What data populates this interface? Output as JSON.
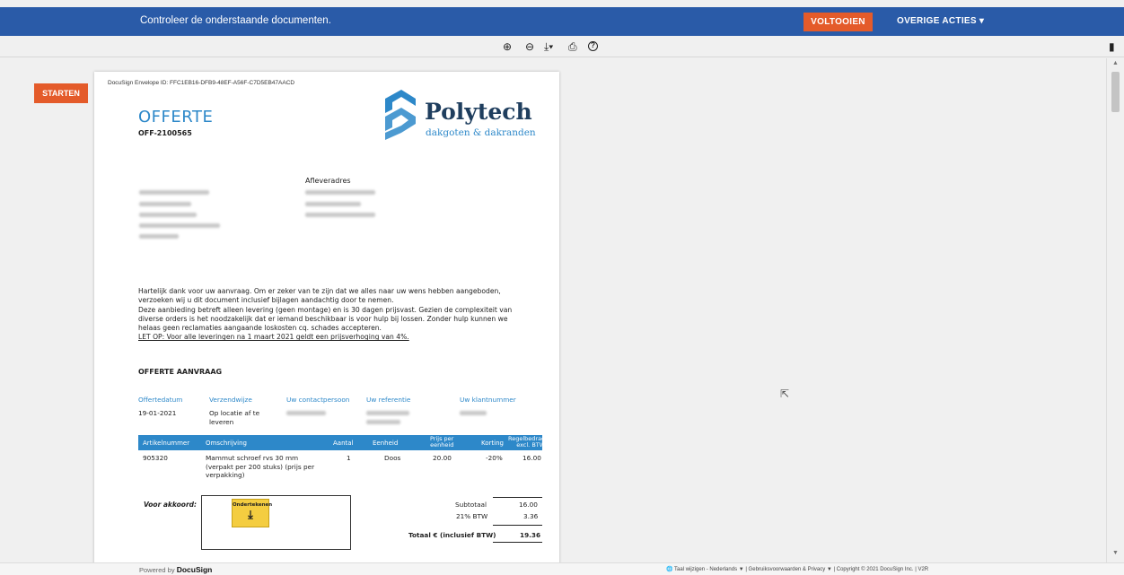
{
  "topbar": {
    "message": "Controleer de onderstaande documenten.",
    "finish_label": "VOLTOOIEN",
    "other_label": "OVERIGE ACTIES ▾",
    "color": "#2a5ba8",
    "accent": "#e45b2a"
  },
  "toolbar": {
    "zoom_in": "⊕",
    "zoom_out": "⊖",
    "download": "⤓▾",
    "print": "⎙",
    "help": "?",
    "side_doc": "▮"
  },
  "start_label": "STARTEN",
  "document": {
    "envelope_id": "DocuSign Envelope ID: FFC1EB16-DFB9-48EF-A56F-C7D5EB47AACD",
    "title": "OFFERTE",
    "number": "OFF-2100565",
    "brand": "Polytech",
    "tagline": "dakgoten & dakranden",
    "delivery_heading": "Afleveradres",
    "intro": [
      "Hartelijk dank voor uw aanvraag. Om er zeker van te zijn dat we alles naar uw wens hebben aangeboden,",
      "verzoeken wij u dit document inclusief bijlagen aandachtig door te nemen.",
      "Deze aanbieding betreft alleen levering (geen montage) en is 30 dagen prijsvast. Gezien de complexiteit van",
      "diverse orders is het noodzakelijk dat er iemand beschikbaar is voor hulp bij lossen. Zonder hulp kunnen we",
      "helaas geen reclamaties aangaande loskosten cq. schades accepteren."
    ],
    "price_note": "LET OP: Voor alle leveringen na 1 maart 2021 geldt een prijsverhoging van 4%.",
    "section": "OFFERTE AANVRAAG",
    "info_headers": [
      "Offertedatum",
      "Verzendwijze",
      "Uw contactpersoon",
      "Uw referentie",
      "Uw klantnummer"
    ],
    "offer_date": "19-01-2021",
    "shipping": [
      "Op locatie af te",
      "leveren"
    ],
    "table_headers": {
      "article": "Artikelnummer",
      "description": "Omschrijving",
      "qty": "Aantal",
      "unit": "Eenheid",
      "price1": "Prijs per",
      "price2": "eenheid",
      "discount": "Korting",
      "line1": "Regelbedrag",
      "line2": "excl. BTW"
    },
    "row": {
      "article": "905320",
      "desc1": "Mammut schroef rvs 30 mm",
      "desc2": "(verpakt per 200 stuks) (prijs per",
      "desc3": "verpakking)",
      "qty": "1",
      "unit": "Doos",
      "price": "20.00",
      "discount": "-20%",
      "line": "16.00"
    },
    "sign_label": "Voor akkoord:",
    "sign_tab": "Ondertekenen",
    "sign_arrow": "⤓",
    "subtotal_label": "Subtotaal",
    "subtotal": "16.00",
    "vat_label": "21% BTW",
    "vat": "3.36",
    "total_label": "Totaal € (inclusief BTW)",
    "total": "19.36"
  },
  "footer": {
    "powered_by": "Powered by",
    "docusign": "DocuSign",
    "links": "🌐 Taal wijzigen - Nederlands ▼   |   Gebruiksvoorwaarden & Privacy ▼   |  Copyright © 2021 DocuSign Inc. | V2R"
  }
}
